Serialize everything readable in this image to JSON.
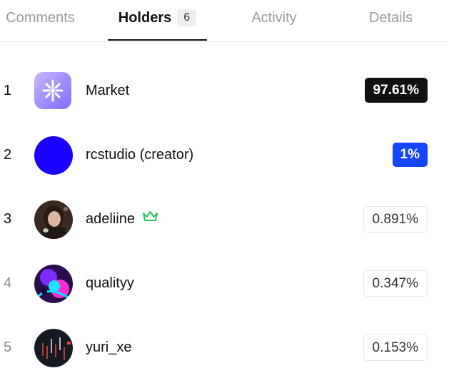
{
  "tabs": [
    {
      "label": "Comments"
    },
    {
      "label": "Holders",
      "count": "6"
    },
    {
      "label": "Activity"
    },
    {
      "label": "Details"
    }
  ],
  "holders": [
    {
      "rank": "1",
      "name": "Market",
      "percent": "97.61%"
    },
    {
      "rank": "2",
      "name": "rcstudio (creator)",
      "percent": "1%"
    },
    {
      "rank": "3",
      "name": "adeliine",
      "percent": "0.891%",
      "badge": "crown-icon"
    },
    {
      "rank": "4",
      "name": "qualityy",
      "percent": "0.347%"
    },
    {
      "rank": "5",
      "name": "yuri_xe",
      "percent": "0.153%"
    }
  ],
  "colors": {
    "accent_blue": "#1545ff",
    "dark_badge": "#111111",
    "crown_green": "#22c55e",
    "rank_muted": "#8a8a8a"
  }
}
